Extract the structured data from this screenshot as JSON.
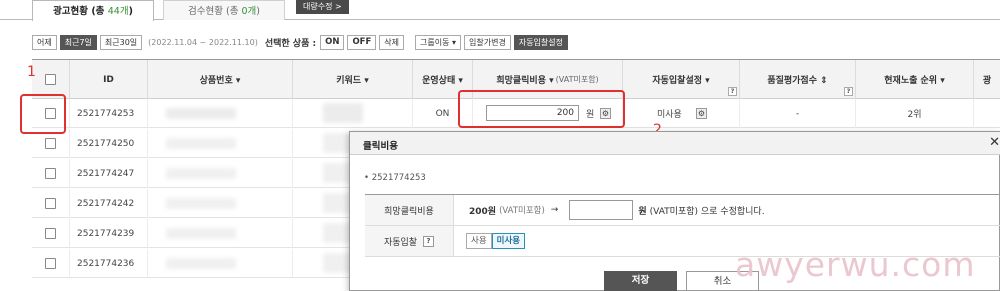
{
  "tabs": {
    "ad_status": {
      "label": "광고현황 (총 ",
      "count": "44개",
      "close": ")"
    },
    "review_status": {
      "label": "검수현황 (총 ",
      "count": "0개",
      "close": ")"
    },
    "bulk": "대량수정 >"
  },
  "filter": {
    "yesterday": "어제",
    "last7": "최근7일",
    "last30": "최근30일",
    "date_range": "(2022.11.04 ~ 2022.11.10)",
    "selected_label": "선택한 상품 :",
    "on": "ON",
    "off": "OFF",
    "delete": "삭제",
    "group_move": "그룹이동 ▾",
    "bid_change": "입찰가변경",
    "auto_bid": "자동입찰설정"
  },
  "columns": {
    "id": "ID",
    "product_no": "상품번호 ▾",
    "keyword": "키워드 ▾",
    "status": "운영상태 ▾",
    "bid": "희망클릭비용 ▾",
    "bid_sub": "(VAT미포함)",
    "auto": "자동입찰설정 ▾",
    "quality": "품질평가점수 ⇕",
    "rank": "현재노출 순위 ▾",
    "extra": "광"
  },
  "rows": [
    {
      "id": "2521774253",
      "status": "ON",
      "bid": "200",
      "won": "원",
      "auto": "미사용",
      "quality": "-",
      "rank": "2위"
    },
    {
      "id": "2521774250"
    },
    {
      "id": "2521774247"
    },
    {
      "id": "2521774242"
    },
    {
      "id": "2521774239"
    },
    {
      "id": "2521774236"
    }
  ],
  "annotations": {
    "one": "1",
    "two": "2"
  },
  "popup": {
    "title": "클릭비용",
    "close": "✕",
    "item_id": "• 2521774253",
    "bid_label": "희망클릭비용",
    "current": "200원",
    "vat": "(VAT미포함)",
    "arrow": "→",
    "unit": "원",
    "suffix": "(VAT미포함) 으로 수정합니다.",
    "auto_label": "자동입찰",
    "help": "?",
    "use": "사용",
    "nouse": "미사용",
    "save": "저장",
    "cancel": "취소"
  },
  "watermark": "awyerwu.com",
  "colors": {
    "annotation": "#e03030",
    "count_green": "#3a8f3a",
    "toggle_active": "#2a8fc0"
  }
}
